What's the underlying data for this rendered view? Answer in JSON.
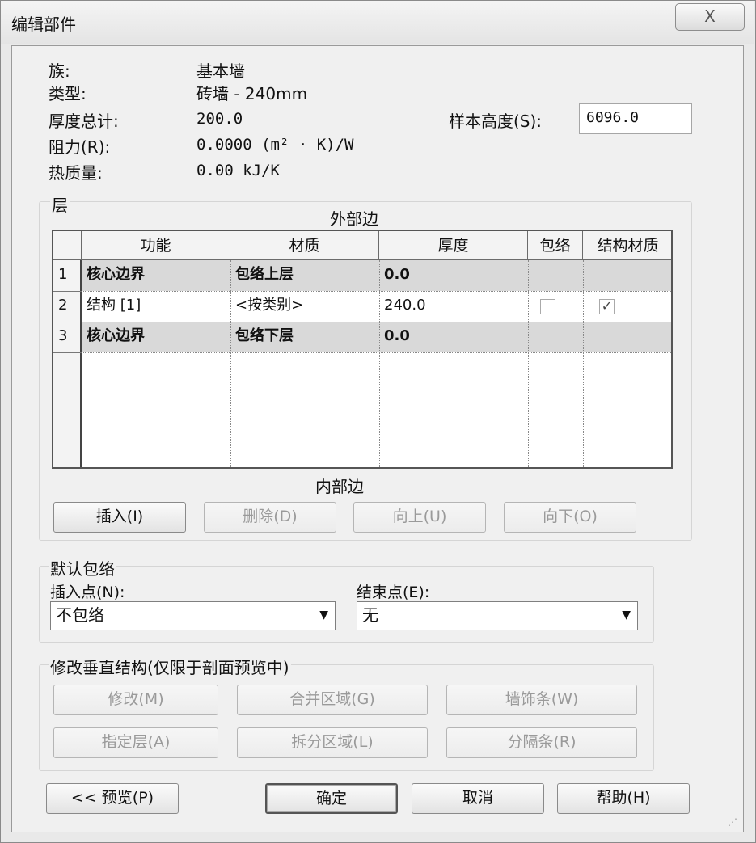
{
  "window": {
    "title": "编辑部件",
    "close_glyph": "X"
  },
  "properties": [
    {
      "label": "族:",
      "value": "基本墙"
    },
    {
      "label": "类型:",
      "value": "砖墙 - 240mm"
    },
    {
      "label": "厚度总计:",
      "value": "200.0"
    },
    {
      "label": "阻力(R):",
      "value": "0.0000 (m² · K)/W"
    },
    {
      "label": "热质量:",
      "value": "0.00 kJ/K"
    }
  ],
  "sample_height": {
    "label": "样本高度(S):",
    "value": "6096.0"
  },
  "layers": {
    "group_label": "层",
    "outer_side": "外部边",
    "inner_side": "内部边",
    "columns": [
      "功能",
      "材质",
      "厚度",
      "包络",
      "结构材质"
    ],
    "rows": [
      {
        "num": "1",
        "function": "核心边界",
        "material": "包络上层",
        "thickness": "0.0",
        "wrap": false,
        "structural": false,
        "core_boundary": true
      },
      {
        "num": "2",
        "function": "结构 [1]",
        "material": "<按类别>",
        "thickness": "240.0",
        "wrap": false,
        "structural": true,
        "core_boundary": false
      },
      {
        "num": "3",
        "function": "核心边界",
        "material": "包络下层",
        "thickness": "0.0",
        "wrap": false,
        "structural": false,
        "core_boundary": true
      }
    ],
    "buttons": {
      "insert": "插入(I)",
      "delete": "删除(D)",
      "up": "向上(U)",
      "down": "向下(O)"
    }
  },
  "default_wrap": {
    "group_label": "默认包络",
    "insert_point_label": "插入点(N):",
    "insert_point_value": "不包络",
    "end_point_label": "结束点(E):",
    "end_point_value": "无"
  },
  "modify_vertical": {
    "group_label": "修改垂直结构(仅限于剖面预览中)",
    "buttons": {
      "modify": "修改(M)",
      "merge": "合并区域(G)",
      "sweeps": "墙饰条(W)",
      "assign": "指定层(A)",
      "split": "拆分区域(L)",
      "reveals": "分隔条(R)"
    }
  },
  "footer": {
    "preview": "<< 预览(P)",
    "ok": "确定",
    "cancel": "取消",
    "help": "帮助(H)"
  }
}
